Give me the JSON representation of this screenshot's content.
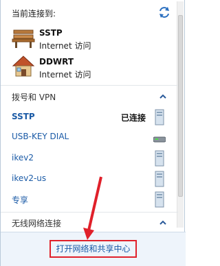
{
  "header": {
    "title": "当前连接到:"
  },
  "connections": [
    {
      "name": "SSTP",
      "access": "Internet 访问",
      "icon": "bench-icon"
    },
    {
      "name": "DDWRT",
      "access": "Internet 访问",
      "icon": "house-icon"
    }
  ],
  "sections": {
    "vpn": {
      "title": "拨号和 VPN"
    },
    "wireless": {
      "title": "无线网络连接"
    }
  },
  "vpn_items": [
    {
      "label": "SSTP",
      "status": "已连接",
      "icon": "server-icon"
    },
    {
      "label": "USB-KEY DIAL",
      "status": "",
      "icon": "modem-icon"
    },
    {
      "label": "ikev2",
      "status": "",
      "icon": "server-icon"
    },
    {
      "label": "ikev2-us",
      "status": "",
      "icon": "server-icon"
    },
    {
      "label": "专享",
      "status": "",
      "icon": "server-icon"
    }
  ],
  "footer": {
    "link": "打开网络和共享中心"
  },
  "colors": {
    "link": "#1a5aa6",
    "highlight": "#e0202a",
    "footer_bg": "#eef4fb"
  }
}
